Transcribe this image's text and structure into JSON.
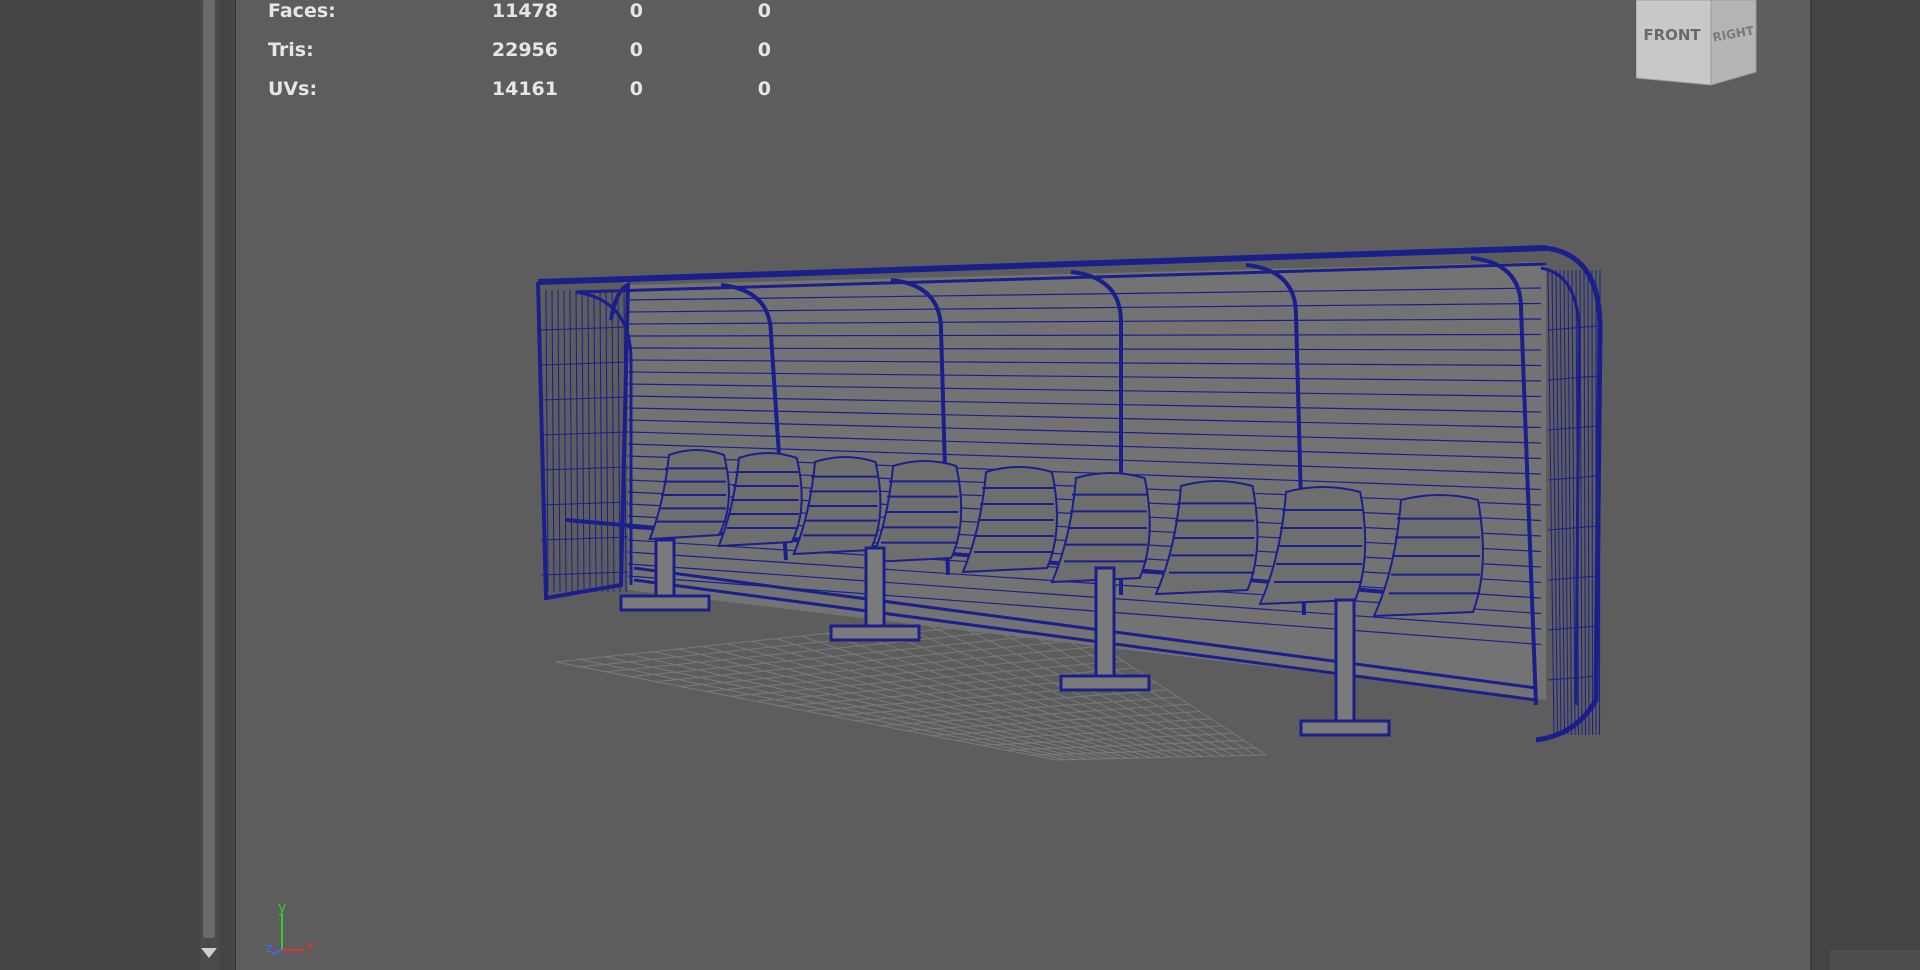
{
  "hud": {
    "rows": [
      {
        "label": "Faces:",
        "v1": "11478",
        "v2": "0",
        "v3": "0"
      },
      {
        "label": "Tris:",
        "v1": "22956",
        "v2": "0",
        "v3": "0"
      },
      {
        "label": "UVs:",
        "v1": "14161",
        "v2": "0",
        "v3": "0"
      }
    ]
  },
  "viewcube": {
    "front": "FRONT",
    "right": "RIGHT"
  },
  "axis": {
    "y": "y",
    "x": "x",
    "z": "z"
  },
  "colors": {
    "wireframe": "#1a1f8c",
    "grid": "#7a7a7a",
    "viewport_bg": "#5d5d5d"
  }
}
